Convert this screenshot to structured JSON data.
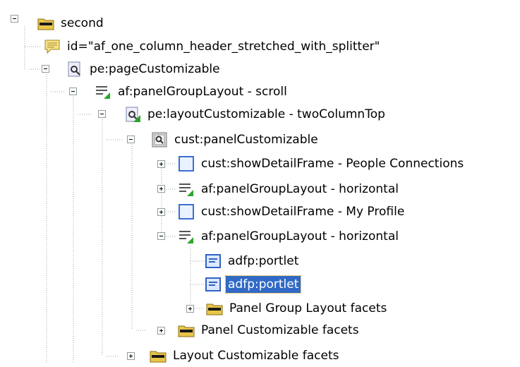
{
  "tree": {
    "nodes": [
      {
        "label": "second",
        "icon": "folder-icon",
        "expander": "minus",
        "selected": false
      },
      {
        "label": "id=\"af_one_column_header_stretched_with_splitter\"",
        "icon": "comment-icon",
        "expander": "none",
        "selected": false
      },
      {
        "label": "pe:pageCustomizable",
        "icon": "customizable-page-icon",
        "expander": "minus",
        "selected": false
      },
      {
        "label": "af:panelGroupLayout - scroll",
        "icon": "panel-group-layout-icon",
        "expander": "minus",
        "selected": false
      },
      {
        "label": "pe:layoutCustomizable - twoColumnTop",
        "icon": "layout-customizable-icon",
        "expander": "minus",
        "selected": false
      },
      {
        "label": "cust:panelCustomizable",
        "icon": "panel-customizable-icon",
        "expander": "minus",
        "selected": false
      },
      {
        "label": "cust:showDetailFrame - People Connections",
        "icon": "show-detail-frame-icon",
        "expander": "plus",
        "selected": false
      },
      {
        "label": "af:panelGroupLayout - horizontal",
        "icon": "panel-group-layout-icon",
        "expander": "plus",
        "selected": false
      },
      {
        "label": "cust:showDetailFrame - My Profile",
        "icon": "show-detail-frame-icon",
        "expander": "plus",
        "selected": false
      },
      {
        "label": "af:panelGroupLayout - horizontal",
        "icon": "panel-group-layout-icon",
        "expander": "minus",
        "selected": false
      },
      {
        "label": "adfp:portlet",
        "icon": "portlet-icon",
        "expander": "none",
        "selected": false
      },
      {
        "label": "adfp:portlet",
        "icon": "portlet-icon",
        "expander": "none",
        "selected": true
      },
      {
        "label": "Panel Group Layout facets",
        "icon": "folder-icon",
        "expander": "plus",
        "selected": false
      },
      {
        "label": "Panel Customizable facets",
        "icon": "folder-icon",
        "expander": "plus",
        "selected": false
      },
      {
        "label": "Layout Customizable facets",
        "icon": "folder-icon",
        "expander": "plus",
        "selected": false
      }
    ]
  },
  "colors": {
    "selection_bg": "#3169c6",
    "selection_text": "#ffffff",
    "tree_line": "#a0a0a0",
    "folder_yellow": "#e8c64a",
    "accent_green": "#2aa52a"
  }
}
